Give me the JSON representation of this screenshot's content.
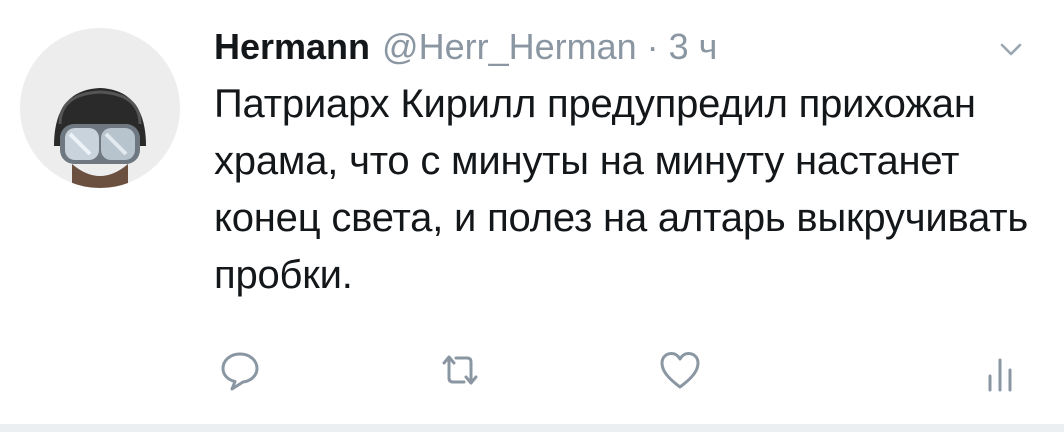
{
  "tweet": {
    "author_name": "Hermann",
    "handle": "@Herr_Herman",
    "separator": "·",
    "time": "3 ч",
    "text": "Патриарх Кирилл предупредил прихожан храма, что с минуты на минуту настанет конец света, и полез на алтарь выкручивать пробки."
  },
  "icons": {
    "menu": "chevron-down-icon",
    "reply": "reply-icon",
    "retweet": "retweet-icon",
    "like": "heart-icon",
    "stats": "analytics-icon"
  },
  "colors": {
    "text": "#14171a",
    "secondary": "#8a97a3",
    "icon": "#8a97a3",
    "divider": "#eceff1"
  }
}
